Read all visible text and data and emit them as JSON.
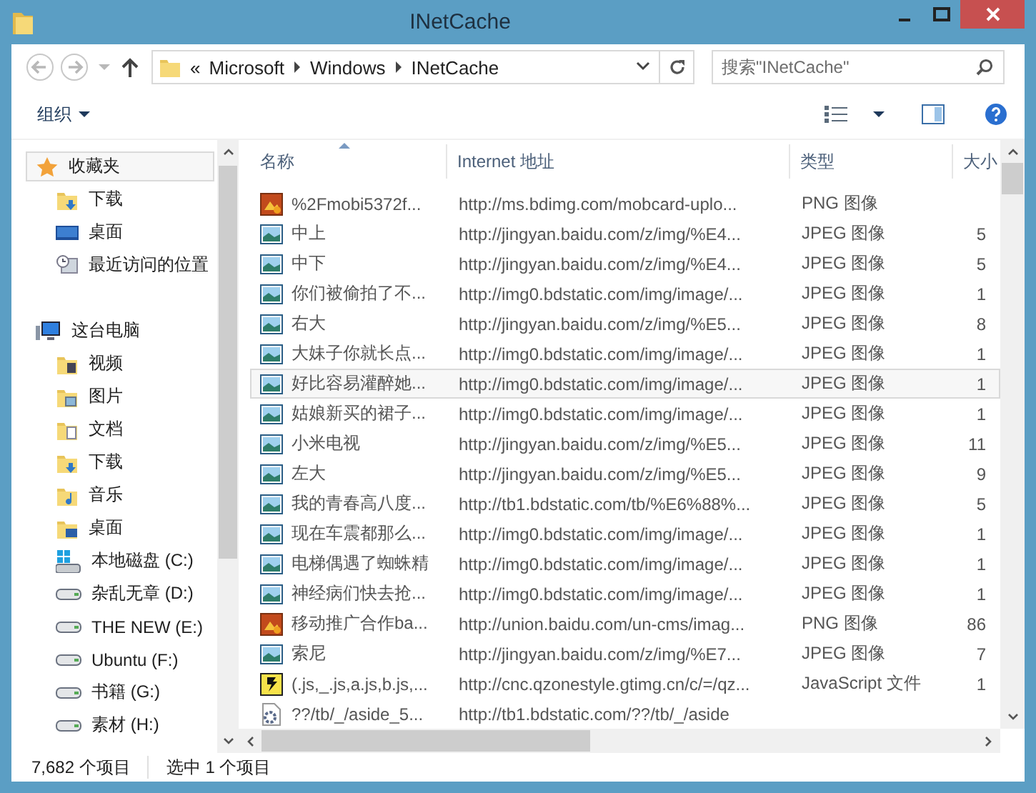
{
  "window": {
    "title": "INetCache"
  },
  "navigation": {
    "overflow": "«",
    "path": [
      "Microsoft",
      "Windows",
      "INetCache"
    ],
    "search": {
      "placeholder": "搜索\"INetCache\""
    }
  },
  "toolbar": {
    "organize": "组织"
  },
  "sidebar": {
    "items": [
      {
        "label": "收藏夹",
        "kind": "star",
        "selected": true,
        "children": [
          {
            "label": "下载",
            "kind": "folder-download",
            "selected": false
          },
          {
            "label": "桌面",
            "kind": "desktop",
            "selected": false
          },
          {
            "label": "最近访问的位置",
            "kind": "recent",
            "selected": false
          }
        ]
      },
      {
        "label": "这台电脑",
        "kind": "computer",
        "selected": false,
        "children": [
          {
            "label": "视频",
            "kind": "folder-video",
            "selected": false
          },
          {
            "label": "图片",
            "kind": "folder-picture",
            "selected": false
          },
          {
            "label": "文档",
            "kind": "folder-document",
            "selected": false
          },
          {
            "label": "下载",
            "kind": "folder-download",
            "selected": false
          },
          {
            "label": "音乐",
            "kind": "folder-music",
            "selected": false
          },
          {
            "label": "桌面",
            "kind": "folder-desktop",
            "selected": false
          },
          {
            "label": "本地磁盘 (C:)",
            "kind": "system-drive",
            "selected": false
          },
          {
            "label": "杂乱无章 (D:)",
            "kind": "drive",
            "selected": false
          },
          {
            "label": "THE NEW (E:)",
            "kind": "drive",
            "selected": false
          },
          {
            "label": "Ubuntu (F:)",
            "kind": "drive",
            "selected": false
          },
          {
            "label": "书籍 (G:)",
            "kind": "drive",
            "selected": false
          },
          {
            "label": "素材 (H:)",
            "kind": "drive",
            "selected": false
          }
        ]
      }
    ]
  },
  "file_list": {
    "columns": [
      "名称",
      "Internet 地址",
      "类型",
      "大小"
    ],
    "rows": [
      {
        "name": "%2Fmobi5372f...",
        "url": "http://ms.bdimg.com/mobcard-uplo...",
        "type": "PNG 图像",
        "kind": "png",
        "selected": false
      },
      {
        "name": "中上",
        "url": "http://jingyan.baidu.com/z/img/%E4...",
        "type": "JPEG 图像",
        "size": "5",
        "kind": "jpeg",
        "selected": false
      },
      {
        "name": "中下",
        "url": "http://jingyan.baidu.com/z/img/%E4...",
        "type": "JPEG 图像",
        "size": "5",
        "kind": "jpeg",
        "selected": false
      },
      {
        "name": "你们被偷拍了不...",
        "url": "http://img0.bdstatic.com/img/image/...",
        "type": "JPEG 图像",
        "size": "1",
        "kind": "jpeg",
        "selected": false
      },
      {
        "name": "右大",
        "url": "http://jingyan.baidu.com/z/img/%E5...",
        "type": "JPEG 图像",
        "size": "8",
        "kind": "jpeg",
        "selected": false
      },
      {
        "name": "大妹子你就长点...",
        "url": "http://img0.bdstatic.com/img/image/...",
        "type": "JPEG 图像",
        "size": "1",
        "kind": "jpeg",
        "selected": false
      },
      {
        "name": "好比容易灌醉她...",
        "url": "http://img0.bdstatic.com/img/image/...",
        "type": "JPEG 图像",
        "size": "1",
        "kind": "jpeg",
        "selected": true
      },
      {
        "name": "姑娘新买的裙子...",
        "url": "http://img0.bdstatic.com/img/image/...",
        "type": "JPEG 图像",
        "size": "1",
        "kind": "jpeg",
        "selected": false
      },
      {
        "name": "小米电视",
        "url": "http://jingyan.baidu.com/z/img/%E5...",
        "type": "JPEG 图像",
        "size": "11",
        "kind": "jpeg",
        "selected": false
      },
      {
        "name": "左大",
        "url": "http://jingyan.baidu.com/z/img/%E5...",
        "type": "JPEG 图像",
        "size": "9",
        "kind": "jpeg",
        "selected": false
      },
      {
        "name": "我的青春高八度...",
        "url": "http://tb1.bdstatic.com/tb/%E6%88%...",
        "type": "JPEG 图像",
        "size": "5",
        "kind": "jpeg",
        "selected": false
      },
      {
        "name": "现在车震都那么...",
        "url": "http://img0.bdstatic.com/img/image/...",
        "type": "JPEG 图像",
        "size": "1",
        "kind": "jpeg",
        "selected": false
      },
      {
        "name": "电梯偶遇了蜘蛛精",
        "url": "http://img0.bdstatic.com/img/image/...",
        "type": "JPEG 图像",
        "size": "1",
        "kind": "jpeg",
        "selected": false
      },
      {
        "name": "神经病们快去抢...",
        "url": "http://img0.bdstatic.com/img/image/...",
        "type": "JPEG 图像",
        "size": "1",
        "kind": "jpeg",
        "selected": false
      },
      {
        "name": "移动推广合作ba...",
        "url": "http://union.baidu.com/un-cms/imag...",
        "type": "PNG 图像",
        "size": "86",
        "kind": "png",
        "selected": false
      },
      {
        "name": "索尼",
        "url": "http://jingyan.baidu.com/z/img/%E7...",
        "type": "JPEG 图像",
        "size": "7",
        "kind": "jpeg",
        "selected": false
      },
      {
        "name": "(.js,_.js,a.js,b.js,...",
        "url": "http://cnc.qzonestyle.gtimg.cn/c/=/qz...",
        "type": "JavaScript 文件",
        "size": "1",
        "kind": "script",
        "selected": false
      },
      {
        "name": "??/tb/_/aside_5...",
        "url": "http://tb1.bdstatic.com/??/tb/_/aside",
        "kind": "generic",
        "selected": false
      }
    ]
  },
  "status_bar": {
    "item_count": "7,682 个项目",
    "selection": "选中 1 个项目"
  }
}
